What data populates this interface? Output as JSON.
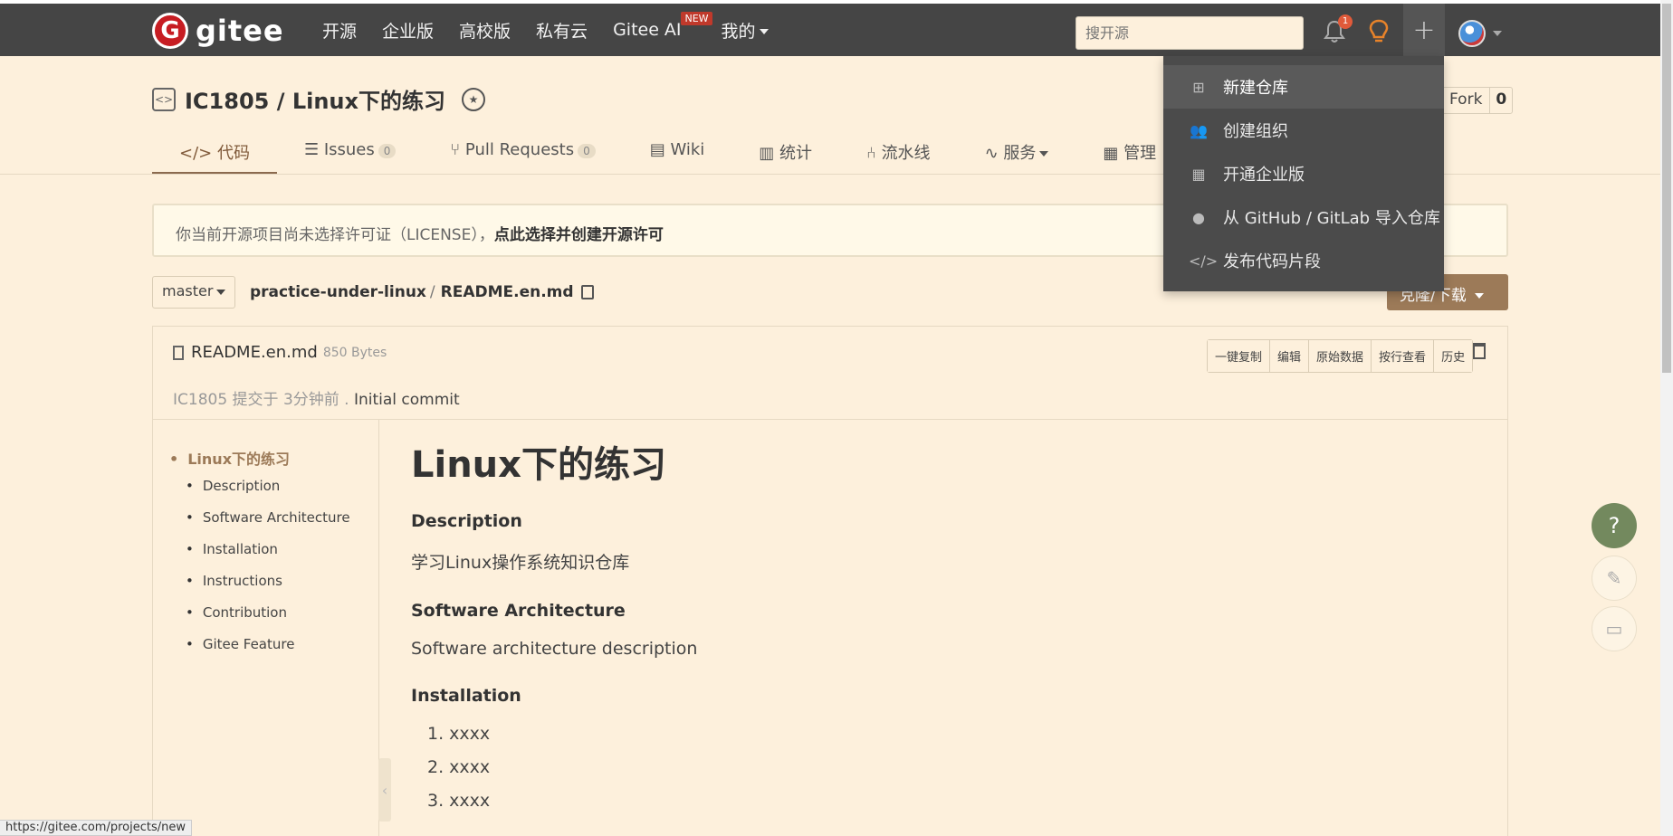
{
  "topbar": {
    "logo_letter": "G",
    "logo_text": "gitee",
    "nav": [
      "开源",
      "企业版",
      "高校版",
      "私有云",
      "Gitee AI",
      "我的"
    ],
    "new_badge": "NEW",
    "search_placeholder": "搜开源",
    "notification_count": "1",
    "plus_symbol": "+"
  },
  "dropdown": {
    "items": [
      "新建仓库",
      "创建组织",
      "开通企业版",
      "从 GitHub / GitLab 导入仓库",
      "发布代码片段"
    ]
  },
  "repo": {
    "title": "IC1805 / Linux下的练习",
    "fork_label": "Fork",
    "fork_count": "0"
  },
  "tabs": [
    {
      "label": "代码"
    },
    {
      "label": "Issues",
      "count": "0"
    },
    {
      "label": "Pull Requests",
      "count": "0"
    },
    {
      "label": "Wiki"
    },
    {
      "label": "统计"
    },
    {
      "label": "流水线"
    },
    {
      "label": "服务"
    },
    {
      "label": "管理"
    }
  ],
  "notice": {
    "text": "你当前开源项目尚未选择许可证（LICENSE），",
    "link": "点此选择并创建开源许可"
  },
  "branch": "master",
  "path": {
    "dir": "practice-under-linux",
    "sep": "/",
    "file": "README.en.md"
  },
  "download_label": "克隆/下载",
  "file": {
    "name": "README.en.md",
    "size": "850 Bytes",
    "actions": [
      "一键复制",
      "编辑",
      "原始数据",
      "按行查看",
      "历史"
    ],
    "commit_meta": "IC1805 提交于 3分钟前 . ",
    "commit_msg": "Initial commit"
  },
  "toc": {
    "root": "Linux下的练习",
    "items": [
      "Description",
      "Software Architecture",
      "Installation",
      "Instructions",
      "Contribution",
      "Gitee Feature"
    ]
  },
  "readme": {
    "h1": "Linux下的练习",
    "sections": [
      {
        "heading": "Description",
        "body": "学习Linux操作系统知识仓库"
      },
      {
        "heading": "Software Architecture",
        "body": "Software architecture description"
      },
      {
        "heading": "Installation"
      }
    ],
    "install_steps": [
      "1. xxxx",
      "2. xxxx",
      "3. xxxx"
    ]
  },
  "fab": {
    "help": "?"
  },
  "status_url": "https://gitee.com/projects/new"
}
